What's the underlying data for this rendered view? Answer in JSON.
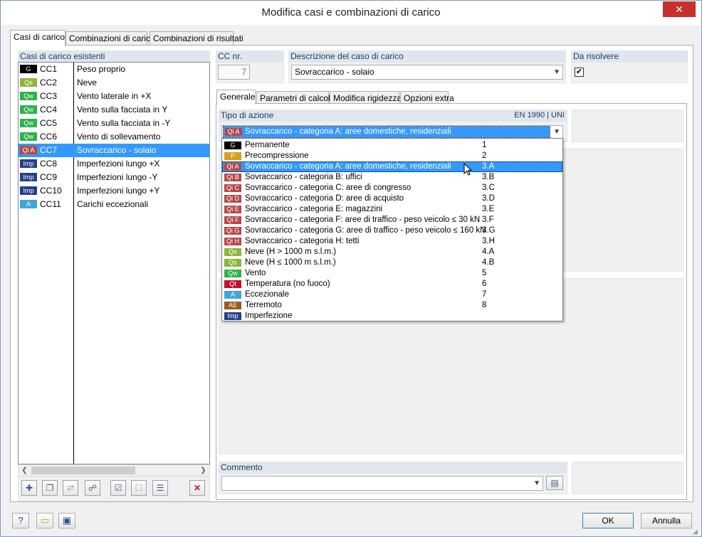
{
  "window": {
    "title": "Modifica casi e combinazioni di carico",
    "close_glyph": "✕"
  },
  "tabs": [
    "Casi di carico",
    "Combinazioni di carico",
    "Combinazioni di risultati"
  ],
  "left_panel": {
    "header": "Casi di carico esistenti",
    "items": [
      {
        "badge": "G",
        "badge_color": "#000000",
        "id": "CC1",
        "desc": "Peso proprio"
      },
      {
        "badge": "Qs",
        "badge_color": "#8db63c",
        "id": "CC2",
        "desc": "Neve"
      },
      {
        "badge": "Qw",
        "badge_color": "#2db34a",
        "id": "CC3",
        "desc": "Vento laterale in +X"
      },
      {
        "badge": "Qw",
        "badge_color": "#2db34a",
        "id": "CC4",
        "desc": "Vento sulla facciata in Y"
      },
      {
        "badge": "Qw",
        "badge_color": "#2db34a",
        "id": "CC5",
        "desc": "Vento sulla facciata in -Y"
      },
      {
        "badge": "Qw",
        "badge_color": "#2db34a",
        "id": "CC6",
        "desc": "Vento di sollevamento"
      },
      {
        "badge": "Qi A",
        "badge_color": "#b5494b",
        "id": "CC7",
        "desc": "Sovraccarico - solaio",
        "selected": true
      },
      {
        "badge": "Imp",
        "badge_color": "#243f8c",
        "id": "CC8",
        "desc": "Imperfezioni lungo +X"
      },
      {
        "badge": "Imp",
        "badge_color": "#243f8c",
        "id": "CC9",
        "desc": "Imperfezioni lungo -Y"
      },
      {
        "badge": "Imp",
        "badge_color": "#243f8c",
        "id": "CC10",
        "desc": "Imperfezioni lungo +Y"
      },
      {
        "badge": "A",
        "badge_color": "#3ea8d8",
        "id": "CC11",
        "desc": "Carichi eccezionali"
      }
    ],
    "toolbar_icons": [
      "new-load-case-icon",
      "copy-load-case-icon",
      "renumber-icon",
      "generate-icon",
      "check-icon",
      "uncheck-icon",
      "sort-icon",
      "delete-icon"
    ]
  },
  "fields": {
    "cc_nr_label": "CC nr.",
    "cc_nr_value": "7",
    "desc_label": "Descrizione del caso di carico",
    "desc_value": "Sovraccarico - solaio",
    "solve_label": "Da risolvere",
    "solve_checked": "✔"
  },
  "subtabs": [
    "Generale",
    "Parametri di calcolo",
    "Modifica rigidezza",
    "Opzioni extra"
  ],
  "action_type": {
    "label": "Tipo di azione",
    "norm": "EN 1990 | UNI",
    "selected_badge": "Qi A",
    "selected_text": "Sovraccarico - categoria A: aree domestiche, residenziali",
    "options": [
      {
        "badge": "G",
        "color": "#000000",
        "name": "Permanente",
        "code": "1"
      },
      {
        "badge": "P",
        "color": "#d4a017",
        "name": "Precompressione",
        "code": "2"
      },
      {
        "badge": "Qi A",
        "color": "#b5494b",
        "name": "Sovraccarico - categoria A: aree domestiche, residenziali",
        "code": "3.A",
        "highlighted": true
      },
      {
        "badge": "Qi B",
        "color": "#b5494b",
        "name": "Sovraccarico - categoria B: uffici",
        "code": "3.B"
      },
      {
        "badge": "Qi C",
        "color": "#b5494b",
        "name": "Sovraccarico - categoria C: aree di congresso",
        "code": "3.C"
      },
      {
        "badge": "Qi D",
        "color": "#b5494b",
        "name": "Sovraccarico - categoria D: aree di acquisto",
        "code": "3.D"
      },
      {
        "badge": "Qi E",
        "color": "#b5494b",
        "name": "Sovraccarico - categoria E: magazzini",
        "code": "3.E"
      },
      {
        "badge": "Qi F",
        "color": "#b5494b",
        "name": "Sovraccarico - categoria F: aree di traffico - peso veicolo ≤ 30 kN",
        "code": "3.F"
      },
      {
        "badge": "Qi G",
        "color": "#b5494b",
        "name": "Sovraccarico - categoria G: aree di traffico - peso veicolo ≤ 160 kN",
        "code": "3.G"
      },
      {
        "badge": "Qi H",
        "color": "#b5494b",
        "name": "Sovraccarico - categoria H: tetti",
        "code": "3.H"
      },
      {
        "badge": "Qs",
        "color": "#8db63c",
        "name": "Neve (H > 1000 m s.l.m.)",
        "code": "4.A"
      },
      {
        "badge": "Qs",
        "color": "#8db63c",
        "name": "Neve (H ≤ 1000 m s.l.m.)",
        "code": "4.B"
      },
      {
        "badge": "Qw",
        "color": "#2db34a",
        "name": "Vento",
        "code": "5"
      },
      {
        "badge": "Qt",
        "color": "#c8102e",
        "name": "Temperatura (no fuoco)",
        "code": "6"
      },
      {
        "badge": "A",
        "color": "#3ea8d8",
        "name": "Eccezionale",
        "code": "7"
      },
      {
        "badge": "AE",
        "color": "#9b5a1a",
        "name": "Terremoto",
        "code": "8"
      },
      {
        "badge": "Imp",
        "color": "#243f8c",
        "name": "Imperfezione",
        "code": ""
      }
    ]
  },
  "comment": {
    "label": "Commento",
    "value": ""
  },
  "buttons": {
    "ok": "OK",
    "cancel": "Annulla"
  }
}
